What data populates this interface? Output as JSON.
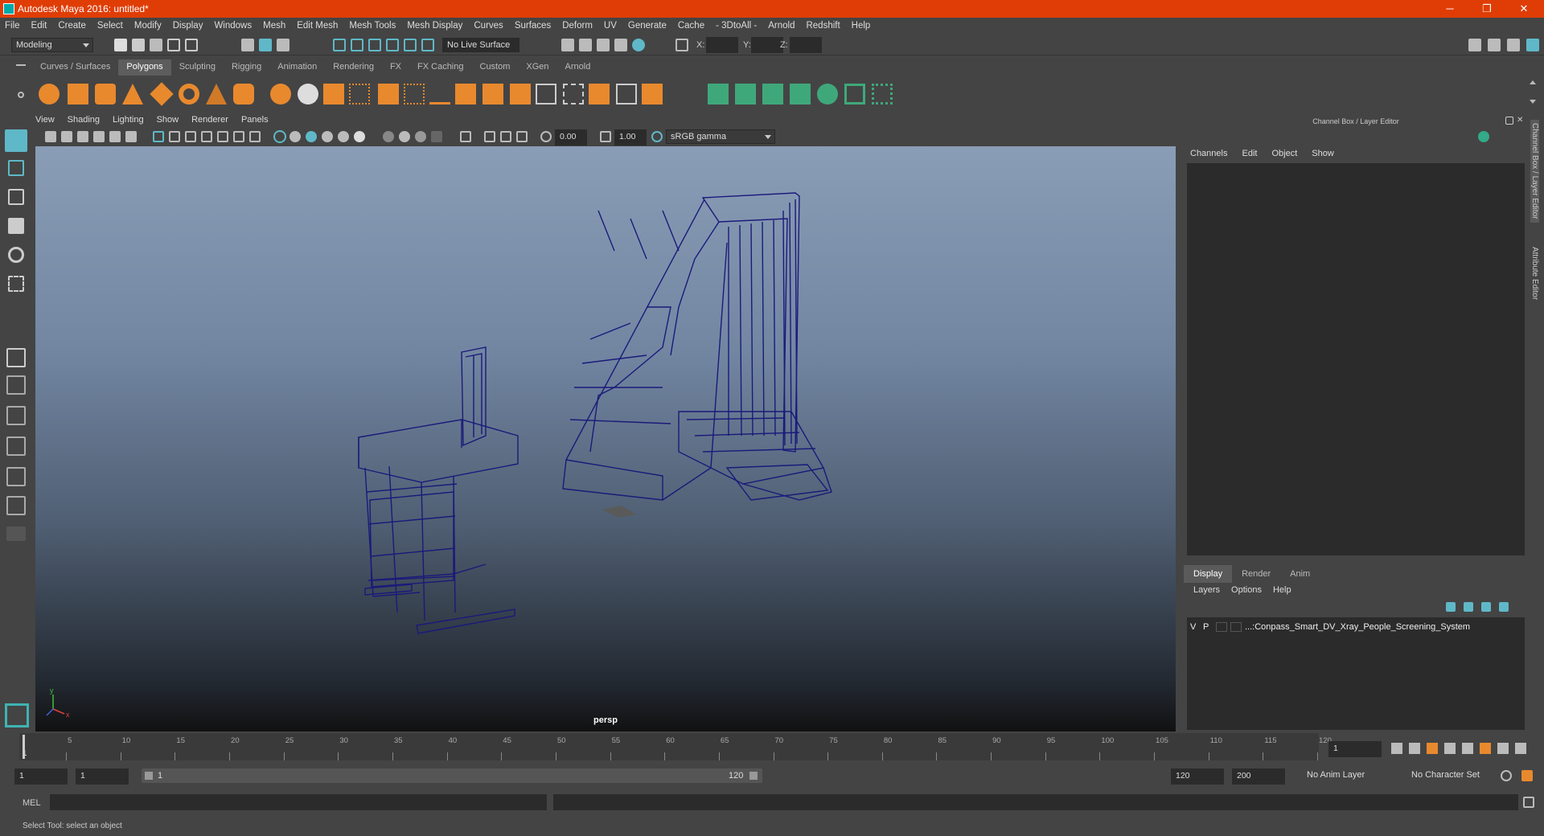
{
  "app": {
    "title": "Autodesk Maya 2016: untitled*",
    "win_minimize": "─",
    "win_restore": "❐",
    "win_close": "✕"
  },
  "menu": [
    "File",
    "Edit",
    "Create",
    "Select",
    "Modify",
    "Display",
    "Windows",
    "Mesh",
    "Edit Mesh",
    "Mesh Tools",
    "Mesh Display",
    "Curves",
    "Surfaces",
    "Deform",
    "UV",
    "Generate",
    "Cache",
    "- 3DtoAll -",
    "Arnold",
    "Redshift",
    "Help"
  ],
  "status": {
    "mode": "Modeling",
    "live_surface": "No Live Surface",
    "x_label": "X:",
    "y_label": "Y:",
    "z_label": "Z:"
  },
  "shelf_tabs": [
    "Curves / Surfaces",
    "Polygons",
    "Sculpting",
    "Rigging",
    "Animation",
    "Rendering",
    "FX",
    "FX Caching",
    "Custom",
    "XGen",
    "Arnold"
  ],
  "shelf_active": "Polygons",
  "viewport": {
    "menu": [
      "View",
      "Shading",
      "Lighting",
      "Show",
      "Renderer",
      "Panels"
    ],
    "exposure": "0.00",
    "gamma": "1.00",
    "colorspace": "sRGB gamma",
    "camera": "persp",
    "axis_y": "y",
    "axis_x": "x"
  },
  "channel_box": {
    "title": "Channel Box / Layer Editor",
    "menu": [
      "Channels",
      "Edit",
      "Object",
      "Show"
    ]
  },
  "layer_editor": {
    "tabs": [
      "Display",
      "Render",
      "Anim"
    ],
    "active": "Display",
    "menu": [
      "Layers",
      "Options",
      "Help"
    ],
    "layer": {
      "v": "V",
      "p": "P",
      "name": "...:Conpass_Smart_DV_Xray_People_Screening_System"
    }
  },
  "side_tabs": [
    "Channel Box / Layer Editor",
    "Attribute Editor"
  ],
  "timeline": {
    "ticks": [
      "5",
      "10",
      "15",
      "20",
      "25",
      "30",
      "35",
      "40",
      "45",
      "50",
      "55",
      "60",
      "65",
      "70",
      "75",
      "80",
      "85",
      "90",
      "95",
      "100",
      "105",
      "110",
      "115",
      "120"
    ],
    "start_marker": "1",
    "current_frame": "1"
  },
  "range": {
    "start": "1",
    "playback_start": "1",
    "slider_left": "1",
    "slider_right": "120",
    "playback_end": "120",
    "end": "200",
    "anim_layer": "No Anim Layer",
    "char_set": "No Character Set"
  },
  "mel": {
    "label": "MEL"
  },
  "help": "Select Tool: select an object",
  "colors": {
    "titlebar": "#e03d06",
    "wire": "#1a1a7a",
    "accent": "#5fb8c8"
  }
}
